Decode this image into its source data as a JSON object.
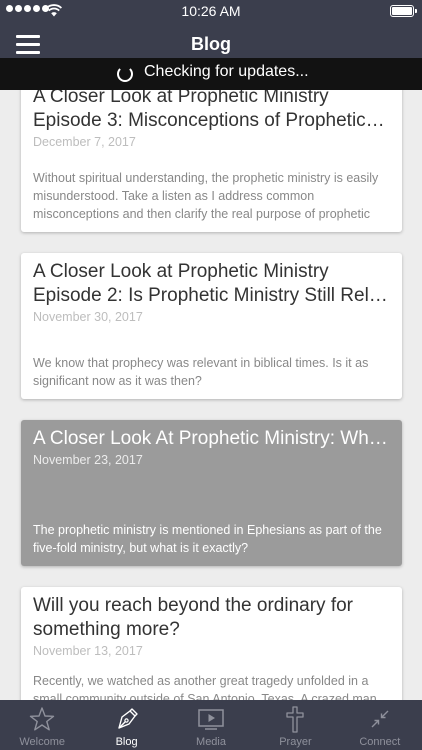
{
  "status_bar": {
    "time": "10:26 AM"
  },
  "header": {
    "title": "Blog"
  },
  "update_banner": {
    "text": "Checking for updates..."
  },
  "posts": [
    {
      "title": "A Closer Look at Prophetic Ministry Episode 3: Misconceptions of Prophetic…",
      "date": "December 7, 2017",
      "excerpt": "Without spiritual understanding, the prophetic ministry is easily misunderstood. Take a listen as I address common misconceptions and then clarify the real purpose of prophetic"
    },
    {
      "title": "A Closer Look at Prophetic Ministry Episode 2: Is Prophetic Ministry Still Rel…",
      "date": "November 30, 2017",
      "excerpt": "We know that prophecy was relevant in biblical times. Is it as significant now as it was then?"
    },
    {
      "title": "A Closer Look At Prophetic Ministry: Wh…",
      "date": "November 23, 2017",
      "excerpt": "The prophetic ministry is mentioned in Ephesians as part of the five-fold ministry, but what is it exactly?"
    },
    {
      "title": "Will you reach beyond the ordinary for something more?",
      "date": "November 13, 2017",
      "excerpt": "Recently, we watched as another great tragedy unfolded in a small community outside of San Antonio, Texas. A crazed man"
    }
  ],
  "tabs": [
    {
      "label": "Welcome",
      "icon": "star-icon"
    },
    {
      "label": "Blog",
      "icon": "pen-nib-icon"
    },
    {
      "label": "Media",
      "icon": "play-screen-icon"
    },
    {
      "label": "Prayer",
      "icon": "cross-icon"
    },
    {
      "label": "Connect",
      "icon": "compress-arrows-icon"
    }
  ],
  "colors": {
    "bar_background": "#3b3e4d",
    "banner_background": "#121212",
    "page_background": "#ededed",
    "selected_card": "#9b9b9b"
  }
}
